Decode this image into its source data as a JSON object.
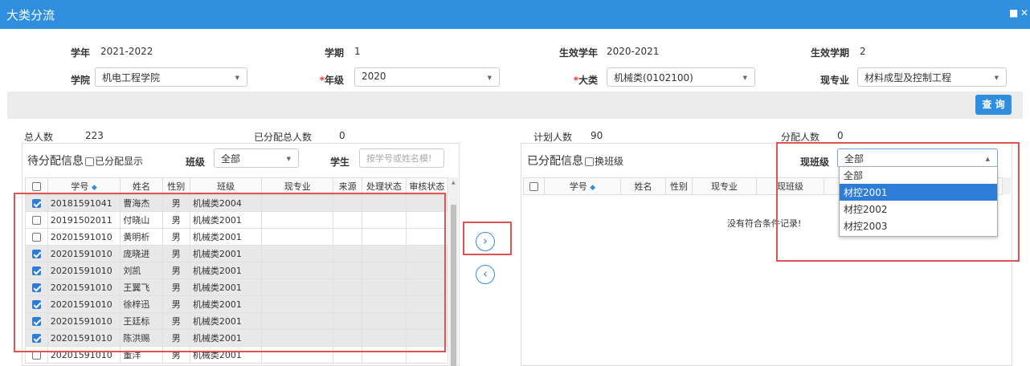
{
  "window": {
    "title": "大类分流"
  },
  "form": {
    "xuenian_label": "学年",
    "xuenian_value": "2021-2022",
    "xueqi_label": "学期",
    "xueqi_value": "1",
    "sx_xuenian_label": "生效学年",
    "sx_xuenian_value": "2020-2021",
    "sx_xueqi_label": "生效学期",
    "sx_xueqi_value": "2",
    "xueyuan_label": "学院",
    "xueyuan_value": "机电工程学院",
    "nianji_label": "年级",
    "nianji_value": "2020",
    "dalei_label": "大类",
    "dalei_value": "机械类(0102100)",
    "xianzhuanye_label": "现专业",
    "xianzhuanye_value": "材料成型及控制工程",
    "required_mark": "*"
  },
  "toolbar": {
    "query_label": "查 询"
  },
  "stats": {
    "total_label": "总人数",
    "total_value": "223",
    "assigned_total_label": "已分配总人数",
    "assigned_total_value": "0",
    "plan_label": "计划人数",
    "plan_value": "90",
    "assign_label": "分配人数",
    "assign_value": "0"
  },
  "left": {
    "header_title": "待分配信息",
    "show_assigned_label": "已分配显示",
    "class_label": "班级",
    "class_value": "全部",
    "student_label": "学生",
    "student_placeholder": "按学号或姓名模!",
    "columns": [
      "学号",
      "姓名",
      "性别",
      "班级",
      "现专业",
      "来源",
      "处理状态",
      "审核状态"
    ],
    "rows": [
      {
        "checked": true,
        "id": "20181591041",
        "name": "曹海杰",
        "gender": "男",
        "class": "机械类2004"
      },
      {
        "checked": false,
        "id": "20191502011",
        "name": "付晓山",
        "gender": "男",
        "class": "机械类2001"
      },
      {
        "checked": false,
        "id": "20201591010",
        "name": "黄明析",
        "gender": "男",
        "class": "机械类2001"
      },
      {
        "checked": true,
        "id": "20201591010",
        "name": "庞晓进",
        "gender": "男",
        "class": "机械类2001"
      },
      {
        "checked": true,
        "id": "20201591010",
        "name": "刘凯",
        "gender": "男",
        "class": "机械类2001"
      },
      {
        "checked": true,
        "id": "20201591010",
        "name": "王翼飞",
        "gender": "男",
        "class": "机械类2001"
      },
      {
        "checked": true,
        "id": "20201591010",
        "name": "徐梓迅",
        "gender": "男",
        "class": "机械类2001"
      },
      {
        "checked": true,
        "id": "20201591010",
        "name": "王廷标",
        "gender": "男",
        "class": "机械类2001"
      },
      {
        "checked": true,
        "id": "20201591010",
        "name": "陈洪赐",
        "gender": "男",
        "class": "机械类2001"
      },
      {
        "checked": false,
        "id": "20201591010",
        "name": "董洋",
        "gender": "男",
        "class": "机械类2001"
      }
    ]
  },
  "right": {
    "header_title": "已分配信息",
    "change_class_label": "换班级",
    "current_class_label": "现班级",
    "current_class_value": "全部",
    "columns": [
      "学号",
      "姓名",
      "性别",
      "现专业",
      "现班级"
    ],
    "empty_text": "没有符合条件记录!",
    "dropdown_options": [
      "全部",
      "材控2001",
      "材控2002",
      "材控2003"
    ],
    "dropdown_highlight_index": 1
  },
  "icons": {
    "move_right": "chevron-right-circle-icon",
    "move_left": "chevron-left-circle-icon"
  },
  "colors": {
    "primary": "#2f8fde",
    "highlight_box": "#e05353",
    "selected_option": "#2d7cd8"
  }
}
